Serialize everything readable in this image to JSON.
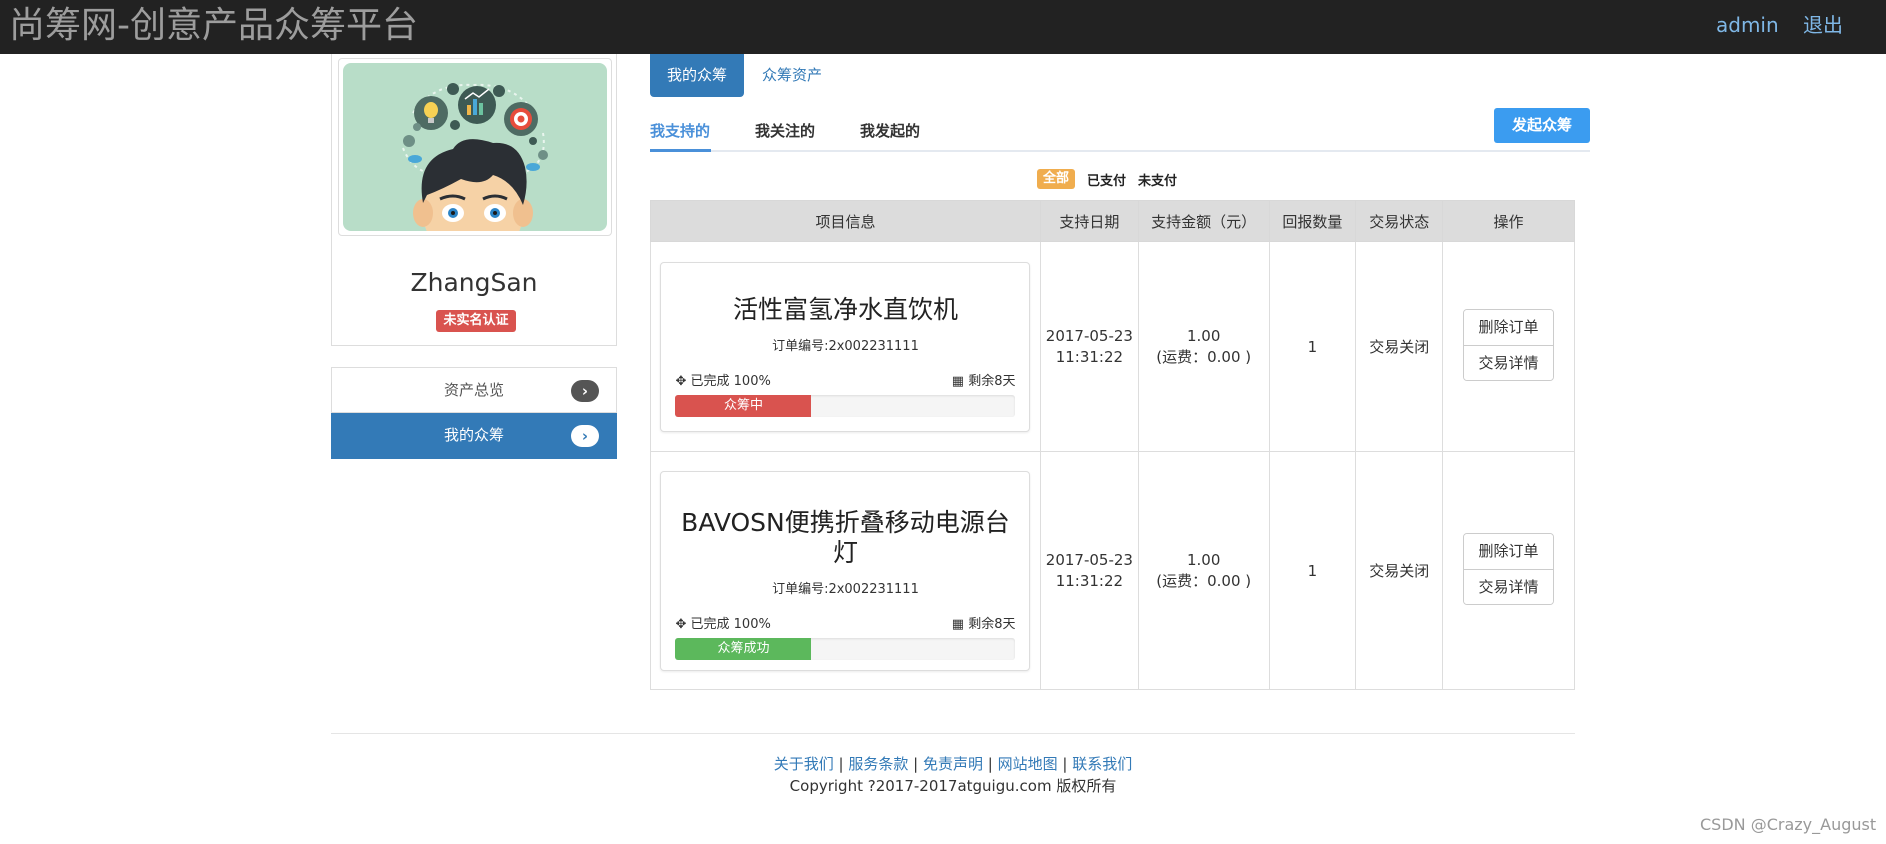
{
  "header": {
    "brand": "尚筹网-创意产品众筹平台",
    "user": "admin",
    "logout": "退出"
  },
  "profile": {
    "username": "ZhangSan",
    "cert_badge": "未实名认证"
  },
  "side_menu": [
    {
      "label": "资产总览",
      "icon": "chevron-right-icon",
      "active": false
    },
    {
      "label": "我的众筹",
      "icon": "chevron-right-icon",
      "active": true
    }
  ],
  "tabs": {
    "primary": "我的众筹",
    "secondary": "众筹资产"
  },
  "subtabs": {
    "supported": "我支持的",
    "followed": "我关注的",
    "launched": "我发起的"
  },
  "launch_button": "发起众筹",
  "filters": {
    "all": "全部",
    "paid": "已支付",
    "unpaid": "未支付"
  },
  "table": {
    "headers": [
      "项目信息",
      "支持日期",
      "支持金额（元）",
      "回报数量",
      "交易状态",
      "操作"
    ],
    "rows": [
      {
        "title": "活性富氢净水直饮机",
        "order_no": "订单编号:2x002231111",
        "completed": "已完成 100%",
        "remaining": "剩余8天",
        "progress_label": "众筹中",
        "progress_fraction": 0.4,
        "progress_color": "#d9534f",
        "date": "2017-05-23",
        "time": "11:31:22",
        "amount": "1.00",
        "shipping": "(运费：0.00 )",
        "qty": "1",
        "status": "交易关闭",
        "delete_btn": "删除订单",
        "detail_btn": "交易详情"
      },
      {
        "title": "BAVOSN便携折叠移动电源台灯",
        "order_no": "订单编号:2x002231111",
        "completed": "已完成 100%",
        "remaining": "剩余8天",
        "progress_label": "众筹成功",
        "progress_fraction": 0.4,
        "progress_color": "#5cb85c",
        "date": "2017-05-23",
        "time": "11:31:22",
        "amount": "1.00",
        "shipping": "(运费：0.00 )",
        "qty": "1",
        "status": "交易关闭",
        "delete_btn": "删除订单",
        "detail_btn": "交易详情"
      }
    ]
  },
  "footer": {
    "links": [
      "关于我们",
      "服务条款",
      "免责声明",
      "网站地图",
      "联系我们"
    ],
    "separator": " | ",
    "copyright": "Copyright ?2017-2017atguigu.com 版权所有"
  },
  "watermark": "CSDN @Crazy_August"
}
